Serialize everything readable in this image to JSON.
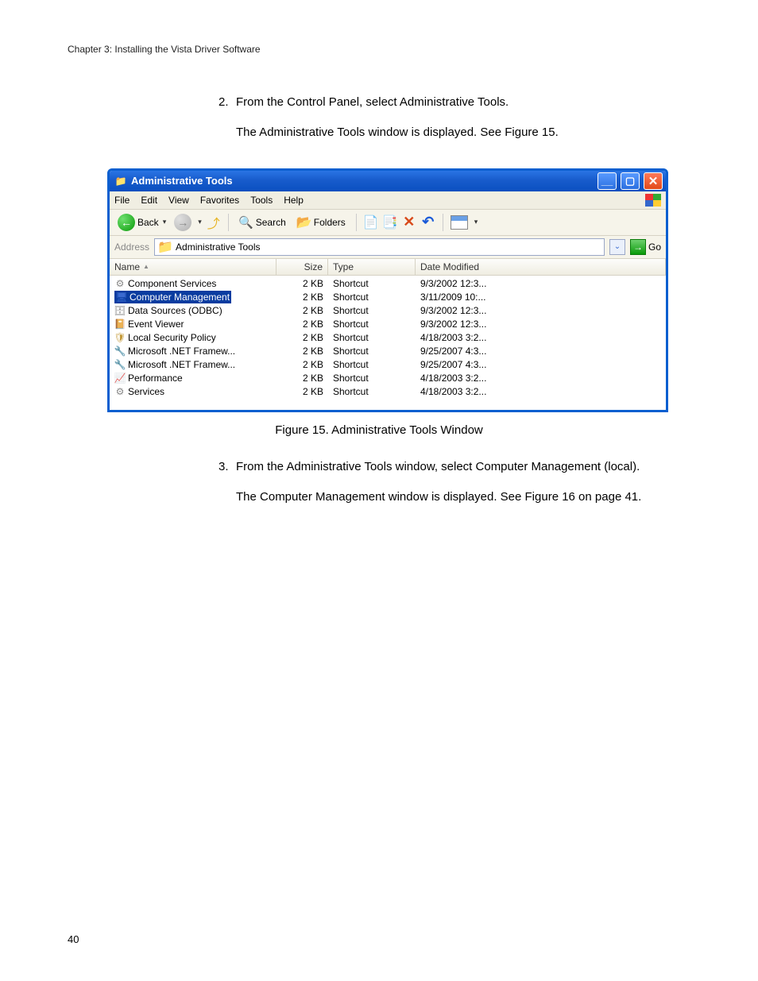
{
  "chapter_header": "Chapter 3: Installing the Vista Driver Software",
  "steps": {
    "s2_num": "2.",
    "s2_text": "From the Control Panel, select Administrative Tools.",
    "s2_sub": "The Administrative Tools window is displayed. See Figure 15.",
    "s3_num": "3.",
    "s3_text": "From the Administrative Tools window, select Computer Management (local).",
    "s3_sub": "The Computer Management window is displayed. See Figure 16 on page 41."
  },
  "figure_caption": "Figure 15. Administrative Tools Window",
  "page_number": "40",
  "window": {
    "title": "Administrative Tools",
    "menu": {
      "file": "File",
      "edit": "Edit",
      "view": "View",
      "favorites": "Favorites",
      "tools": "Tools",
      "help": "Help"
    },
    "toolbar": {
      "back": "Back",
      "search": "Search",
      "folders": "Folders"
    },
    "address": {
      "label": "Address",
      "value": "Administrative Tools",
      "go": "Go"
    },
    "columns": {
      "name": "Name",
      "size": "Size",
      "type": "Type",
      "date": "Date Modified"
    },
    "rows": [
      {
        "name": "Component Services",
        "size": "2 KB",
        "type": "Shortcut",
        "date": "9/3/2002 12:3...",
        "icon": "ic-gears",
        "selected": false
      },
      {
        "name": "Computer Management",
        "size": "2 KB",
        "type": "Shortcut",
        "date": "3/11/2009 10:...",
        "icon": "ic-comp",
        "selected": true
      },
      {
        "name": "Data Sources (ODBC)",
        "size": "2 KB",
        "type": "Shortcut",
        "date": "9/3/2002 12:3...",
        "icon": "ic-db",
        "selected": false
      },
      {
        "name": "Event Viewer",
        "size": "2 KB",
        "type": "Shortcut",
        "date": "9/3/2002 12:3...",
        "icon": "ic-event",
        "selected": false
      },
      {
        "name": "Local Security Policy",
        "size": "2 KB",
        "type": "Shortcut",
        "date": "4/18/2003 3:2...",
        "icon": "ic-sec",
        "selected": false
      },
      {
        "name": "Microsoft .NET Framew...",
        "size": "2 KB",
        "type": "Shortcut",
        "date": "9/25/2007 4:3...",
        "icon": "ic-net",
        "selected": false
      },
      {
        "name": "Microsoft .NET Framew...",
        "size": "2 KB",
        "type": "Shortcut",
        "date": "9/25/2007 4:3...",
        "icon": "ic-net",
        "selected": false
      },
      {
        "name": "Performance",
        "size": "2 KB",
        "type": "Shortcut",
        "date": "4/18/2003 3:2...",
        "icon": "ic-perf",
        "selected": false
      },
      {
        "name": "Services",
        "size": "2 KB",
        "type": "Shortcut",
        "date": "4/18/2003 3:2...",
        "icon": "ic-gears",
        "selected": false
      }
    ]
  }
}
